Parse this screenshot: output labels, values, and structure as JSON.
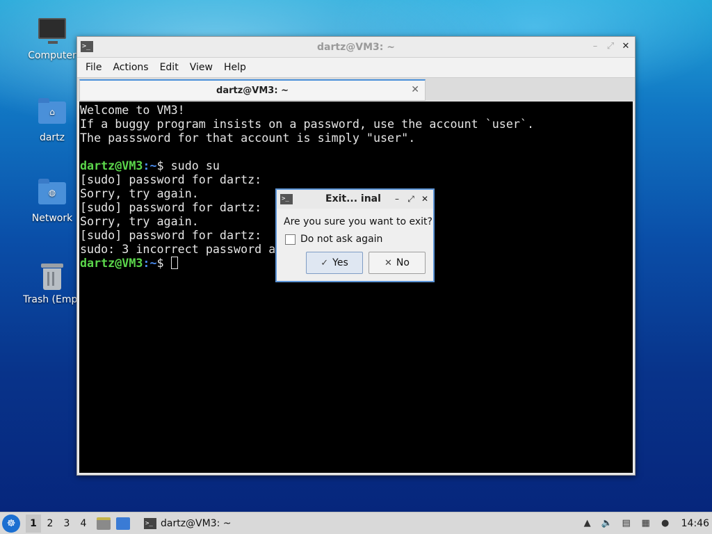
{
  "desktop": {
    "icons": [
      {
        "label": "Computer",
        "icon": "computer-icon"
      },
      {
        "label": "dartz",
        "icon": "home-folder-icon"
      },
      {
        "label": "Network",
        "icon": "network-folder-icon"
      },
      {
        "label": "Trash (Empt",
        "icon": "trash-icon"
      }
    ]
  },
  "terminal": {
    "title": "dartz@VM3: ~",
    "menu": [
      "File",
      "Actions",
      "Edit",
      "View",
      "Help"
    ],
    "tab_label": "dartz@VM3: ~",
    "lines": [
      "Welcome to VM3!",
      "If a buggy program insists on a password, use the account `user`.",
      "The passsword for that account is simply \"user\".",
      "",
      "[sudo] password for dartz:",
      "Sorry, try again.",
      "[sudo] password for dartz:",
      "Sorry, try again.",
      "[sudo] password for dartz:",
      "sudo: 3 incorrect password a"
    ],
    "prompt_user": "dartz@VM3",
    "prompt_sep": ":",
    "prompt_path": "~",
    "prompt_symbol": "$ ",
    "command_1": "sudo su"
  },
  "dialog": {
    "title": "Exit... inal",
    "message": "Are you sure you want to exit?",
    "checkbox_label": "Do not ask again",
    "checkbox_checked": false,
    "yes_label": "Yes",
    "no_label": "No"
  },
  "taskbar": {
    "workspaces": [
      "1",
      "2",
      "3",
      "4"
    ],
    "active_workspace": "1",
    "task_label": "dartz@VM3: ~",
    "clock": "14:46"
  }
}
